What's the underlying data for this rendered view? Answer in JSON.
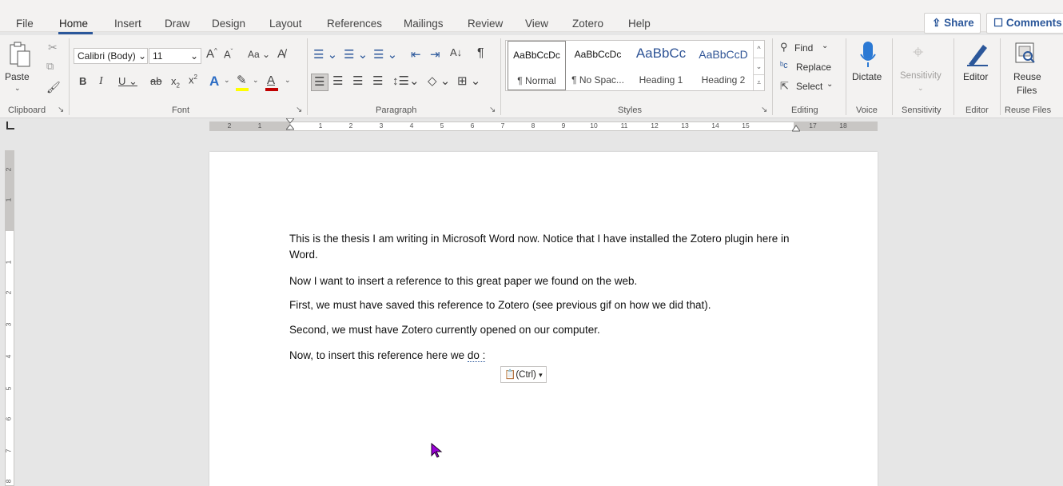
{
  "tabs": [
    "File",
    "Home",
    "Insert",
    "Draw",
    "Design",
    "Layout",
    "References",
    "Mailings",
    "Review",
    "View",
    "Zotero",
    "Help"
  ],
  "actions": {
    "share": "Share",
    "comments": "Comments"
  },
  "clipboard": {
    "paste": "Paste",
    "label": "Clipboard"
  },
  "font": {
    "name": "Calibri (Body)",
    "size": "11",
    "label": "Font",
    "case": "Aa"
  },
  "paragraph": {
    "label": "Paragraph"
  },
  "styles": {
    "label": "Styles",
    "items": [
      {
        "preview": "AaBbCcDc",
        "name": "¶ Normal"
      },
      {
        "preview": "AaBbCcDc",
        "name": "¶ No Spac..."
      },
      {
        "preview": "AaBbCc",
        "name": "Heading 1"
      },
      {
        "preview": "AaBbCcD",
        "name": "Heading 2"
      }
    ]
  },
  "editing": {
    "find": "Find",
    "replace": "Replace",
    "select": "Select",
    "label": "Editing"
  },
  "voice": {
    "dictate": "Dictate",
    "label": "Voice"
  },
  "sensitivity": {
    "button": "Sensitivity",
    "label": "Sensitivity"
  },
  "editor": {
    "button": "Editor",
    "label": "Editor"
  },
  "reuse": {
    "line1": "Reuse",
    "line2": "Files",
    "label": "Reuse Files"
  },
  "ruler": {
    "left_nums": [
      "2",
      "1"
    ],
    "nums": [
      "1",
      "2",
      "3",
      "4",
      "5",
      "6",
      "7",
      "8",
      "9",
      "10",
      "11",
      "12",
      "13",
      "14",
      "15",
      "17",
      "18"
    ]
  },
  "vruler": {
    "nums": [
      "2",
      "1",
      "1",
      "2",
      "3",
      "4",
      "5",
      "6",
      "7",
      "8"
    ]
  },
  "document": {
    "paragraphs": [
      "This is the thesis I am writing in Microsoft Word now. Notice that I have installed the Zotero plugin here in Word.",
      "Now I want to insert a reference to this great paper we found on the web.",
      "First, we must have saved this reference to Zotero (see previous gif on how we did that).",
      "Second, we must have Zotero currently opened on our computer."
    ],
    "last_line_prefix": "Now, to insert this reference here we ",
    "last_line_flagged": "do :"
  },
  "paste_options": {
    "label": "(Ctrl)"
  },
  "colors": {
    "accent": "#2b579a",
    "highlight": "#ffff00",
    "font_color": "#c00000",
    "cursor": "#9b00d9"
  }
}
